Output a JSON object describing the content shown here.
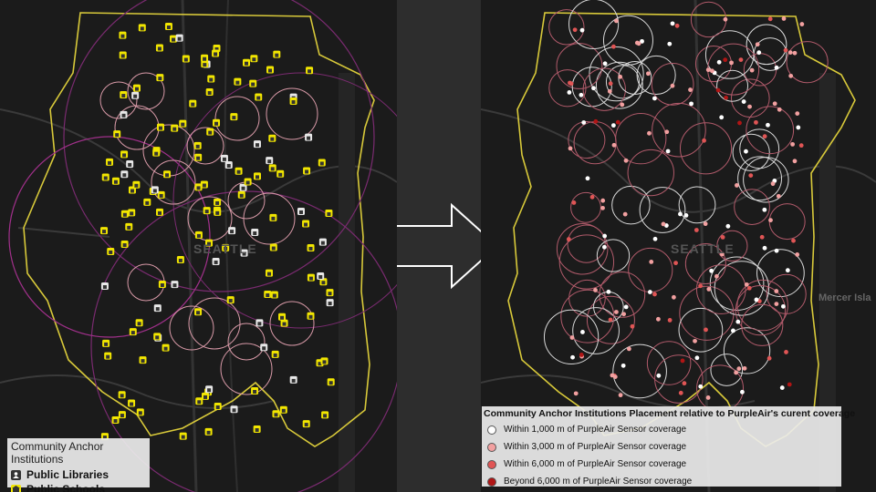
{
  "left_map": {
    "city_label": "SEATTLE",
    "legend": {
      "title": "Community Anchor Institutions",
      "items": [
        {
          "label": "Public Libraries",
          "icon": "library-icon",
          "color": "#ffffff"
        },
        {
          "label": "Public Schools",
          "icon": "school-icon",
          "color": "#f2e600"
        }
      ]
    }
  },
  "right_map": {
    "city_label": "SEATTLE",
    "neighbor_label": "Mercer Isla",
    "legend": {
      "title": "Community Anchor Institutions Placement relative to PurpleAir's curent coverage",
      "items": [
        {
          "label": "Within 1,000 m of PurpleAir Sensor coverage",
          "color": "#ffffff"
        },
        {
          "label": "Within 3,000 m of PurpleAir Sensor coverage",
          "color": "#f2a0a0"
        },
        {
          "label": "Within 6,000 m of PurpleAir Sensor coverage",
          "color": "#e05555"
        },
        {
          "label": "Beyond 6,000 m of PurpleAir Sensor coverage",
          "color": "#b01515"
        }
      ]
    }
  },
  "colors": {
    "boundary": "#d8c93a",
    "buffer_outline_pink": "#d99aa8",
    "buffer_outline_magenta": "#a0308a",
    "arrow": "#ffffff"
  },
  "arrow_icon": "right-arrow-icon"
}
